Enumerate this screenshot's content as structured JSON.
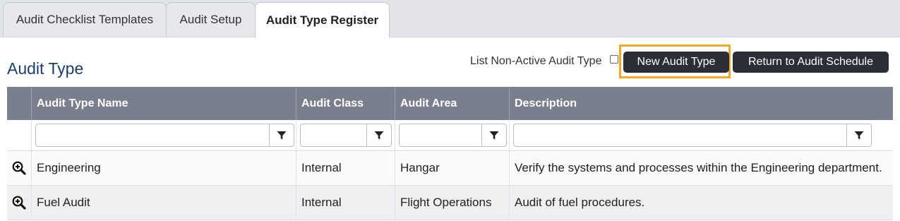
{
  "tabs": [
    {
      "label": "Audit Checklist Templates",
      "active": false
    },
    {
      "label": "Audit Setup",
      "active": false
    },
    {
      "label": "Audit Type Register",
      "active": true
    }
  ],
  "page": {
    "title": "Audit Type",
    "non_active_label": "List Non-Active Audit Type",
    "new_button_label": "New Audit Type",
    "return_button_label": "Return to Audit Schedule"
  },
  "grid": {
    "columns": [
      "Audit Type Name",
      "Audit Class",
      "Audit Area",
      "Description"
    ],
    "rows": [
      {
        "name": "Engineering",
        "class": "Internal",
        "area": "Hangar",
        "description": "Verify the systems and processes within the Engineering department."
      },
      {
        "name": "Fuel Audit",
        "class": "Internal",
        "area": "Flight Operations",
        "description": "Audit of fuel procedures."
      }
    ]
  },
  "icons": {
    "row_view": "zoom-in-icon",
    "filter": "funnel-icon"
  },
  "colors": {
    "header_bg": "#7a7f8d",
    "button_bg": "#2b2e36",
    "title": "#1d3d6b",
    "highlight": "#f5a623"
  }
}
